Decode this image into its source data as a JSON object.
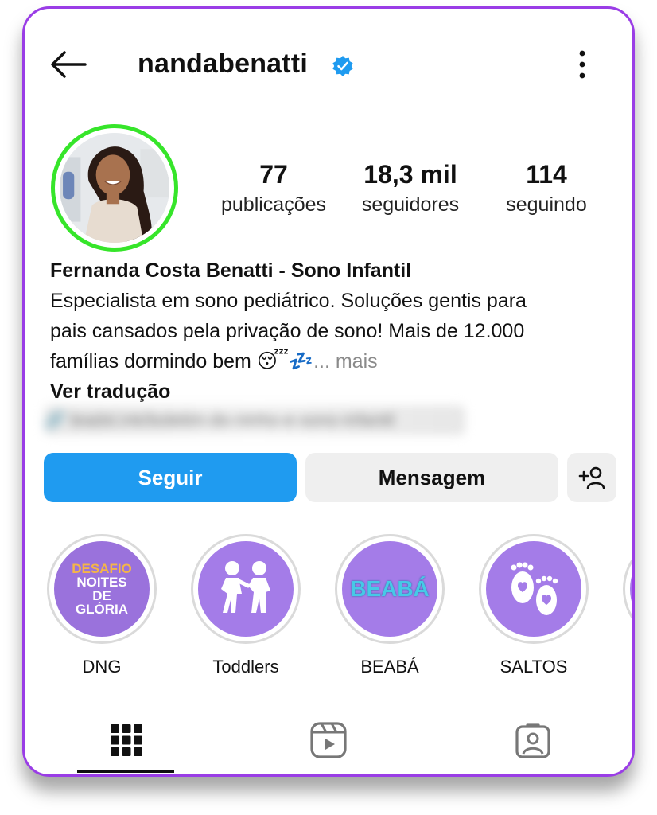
{
  "profile": {
    "username": "nandabenatti",
    "display_name": "Fernanda Costa Benatti - Sono Infantil",
    "bio_line1": "Especialista em sono pediátrico. Soluções gentis para",
    "bio_line2": "pais cansados pela privação de sono! Mais de 12.000",
    "bio_line3": "famílias dormindo bem 😴💤",
    "bio_more": "... mais",
    "translate": "Ver tradução",
    "link_blurred": "🔗 leadsl.ink/boletim-do-ninho-e-sono-infantil"
  },
  "stats": [
    {
      "value": "77",
      "label": "publicações"
    },
    {
      "value": "18,3 mil",
      "label": "seguidores"
    },
    {
      "value": "114",
      "label": "seguindo"
    }
  ],
  "actions": {
    "follow": "Seguir",
    "message": "Mensagem"
  },
  "highlights": [
    {
      "label": "DNG",
      "art_line1": "DESAFIO",
      "art_line2": "NOITES",
      "art_line3": "DE",
      "art_line4": "GLÓRIA"
    },
    {
      "label": "Toddlers"
    },
    {
      "label": "BEABÁ",
      "art": "BEABÁ"
    },
    {
      "label": "SALTOS"
    }
  ],
  "colors": {
    "accent_border": "#9a3de6",
    "follow_button": "#1f9bf0",
    "story_ring": "#36e52a",
    "highlight_fill": "#a47ce8",
    "verified_badge": "#1f9bf0"
  },
  "icons": {
    "back": "arrow-left-icon",
    "verified": "verified-badge-icon",
    "more": "more-vertical-icon",
    "add_person": "add-person-icon",
    "grid": "grid-icon",
    "reels": "reels-icon",
    "tagged": "tagged-icon"
  }
}
